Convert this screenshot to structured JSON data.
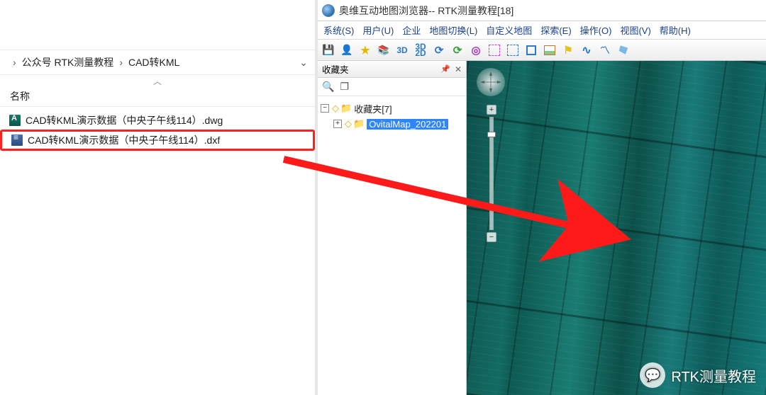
{
  "explorer": {
    "crumb1": "公众号 RTK测量教程",
    "crumb2": "CAD转KML",
    "col_name": "名称",
    "files": {
      "dwg": "CAD转KML演示数据（中央子午线114）.dwg",
      "dxf": "CAD转KML演示数据（中央子午线114）.dxf"
    }
  },
  "omap": {
    "title": "奥维互动地图浏览器-- RTK测量教程[18]",
    "menu": {
      "system": "系统(S)",
      "user": "用户(U)",
      "enterprise": "企业",
      "mapswitch": "地图切换(L)",
      "custommap": "自定义地图",
      "explore": "探索(E)",
      "operate": "操作(O)",
      "view": "视图(V)",
      "help": "帮助(H)"
    },
    "toolbar": {
      "t3d": "3D",
      "t3d2d": "3D\n2D"
    },
    "fav": {
      "title": "收藏夹",
      "root": "收藏夹[7]",
      "item1": "OvitalMap_202201"
    }
  },
  "watermark": {
    "text": "RTK测量教程"
  }
}
